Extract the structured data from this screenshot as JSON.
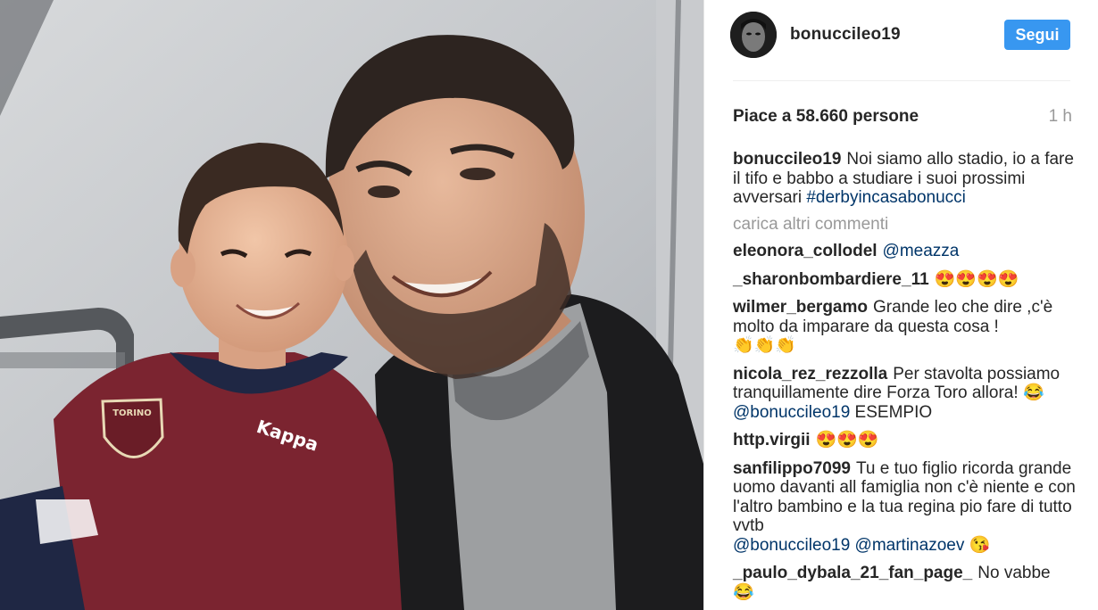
{
  "post": {
    "username": "bonuccileo19",
    "follow_label": "Segui",
    "likes": "Piace a 58.660 persone",
    "time": "1 h",
    "load_more": "carica altri commenti"
  },
  "caption": {
    "author": "bonuccileo19",
    "text": "Noi siamo allo stadio, io a fare il tifo e babbo a studiare i suoi prossimi avversari",
    "hashtag": "#derbyincasabonucci"
  },
  "photo": {
    "jersey_text": "Kappa",
    "badge_text": "TORINO"
  },
  "comments": [
    {
      "author": "eleonora_collodel",
      "mention": "@meazza"
    },
    {
      "author": "_sharonbombardiere_11",
      "emoji": "😍😍😍😍"
    },
    {
      "author": "wilmer_bergamo",
      "text": "Grande leo che dire ,c'è molto da imparare da questa cosa !",
      "emoji": "👏👏👏"
    },
    {
      "author": "nicola_rez_rezzolla",
      "text": "Per stavolta possiamo tranquillamente dire Forza Toro allora!",
      "emoji": "😂",
      "mention": "@bonuccileo19",
      "text_after": "ESEMPIO"
    },
    {
      "author": "http.virgii",
      "emoji": "😍😍😍"
    },
    {
      "author": "sanfilippo7099",
      "text": "Tu e tuo figlio ricorda grande uomo davanti all famiglia non c'è niente e con l'altro bambino e la tua regina pio fare di tutto vvtb",
      "mention": "@bonuccileo19",
      "mention2": "@martinazoev",
      "emoji": "😘"
    },
    {
      "author": "_paulo_dybala_21_fan_page_",
      "text": "No vabbe",
      "emoji": "😂"
    }
  ],
  "colors": {
    "follow_button": "#3897f0",
    "link": "#003569",
    "muted": "#999999",
    "text": "#262626"
  }
}
